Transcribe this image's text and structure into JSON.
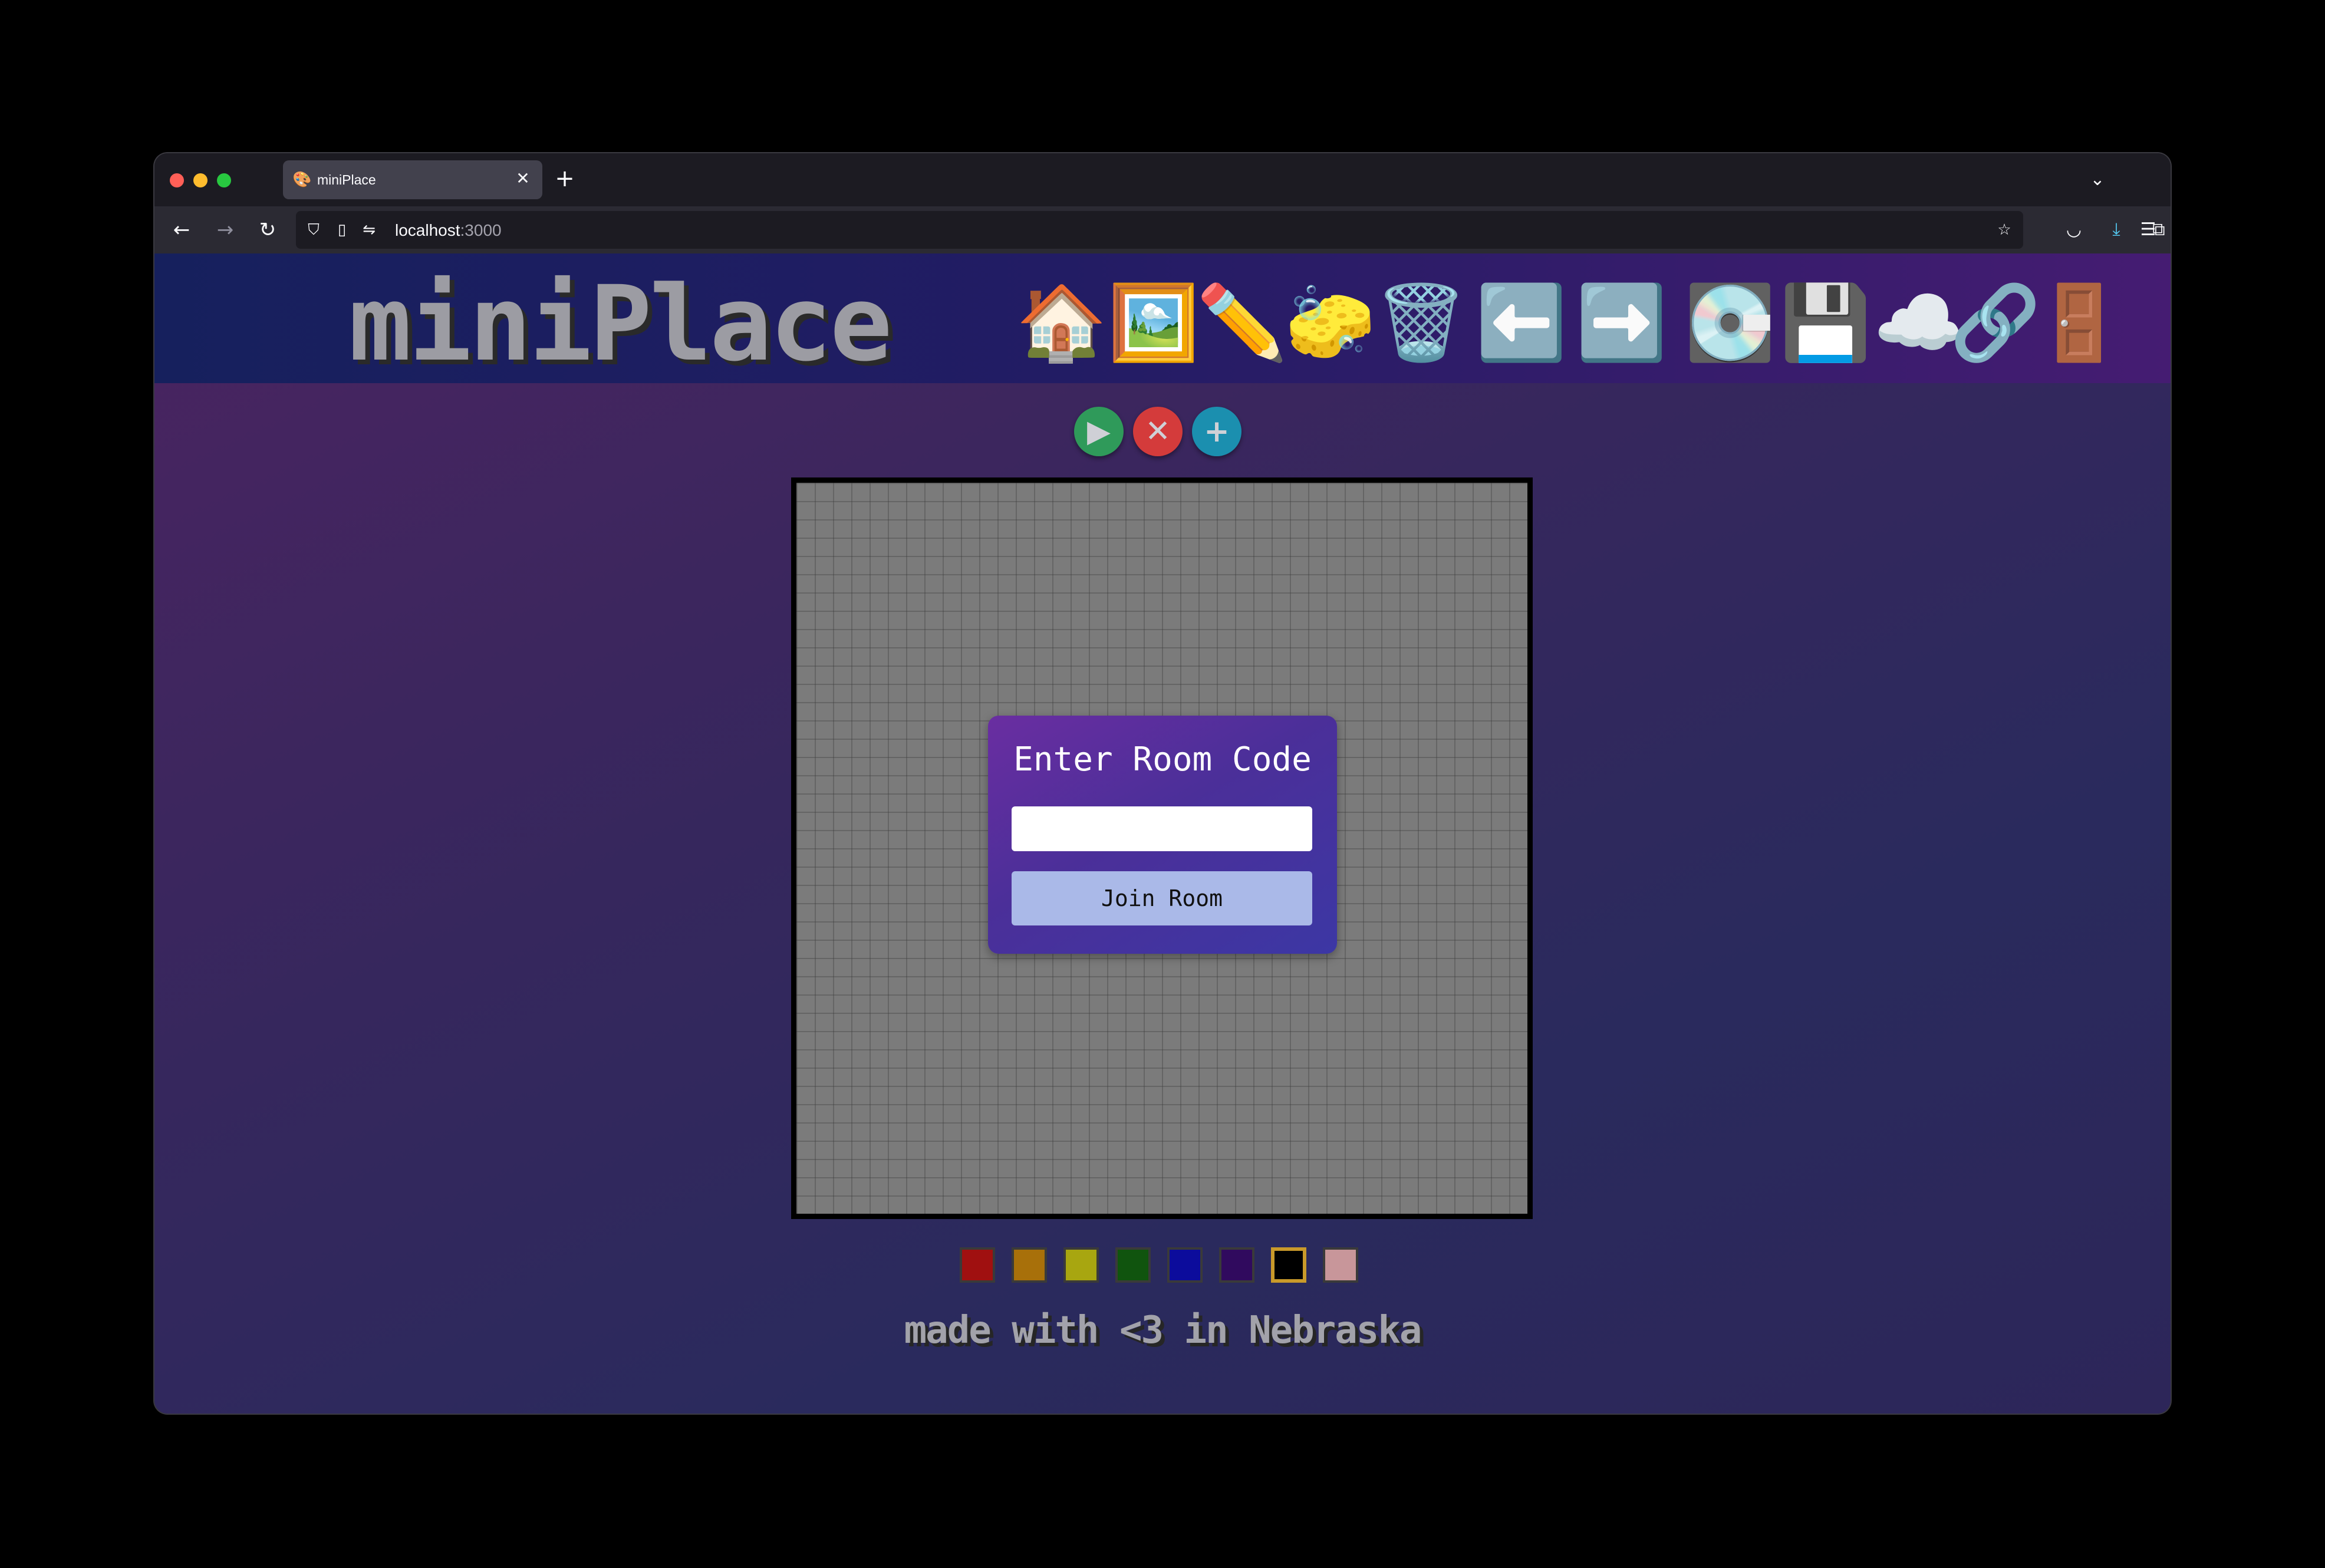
{
  "browser": {
    "tab_title": "miniPlace",
    "tab_favicon": "🎨",
    "tab_close": "✕",
    "new_tab": "+",
    "tab_list": "⌄",
    "url_host": "localhost",
    "url_port": ":3000"
  },
  "header": {
    "logo_text": "miniPlace",
    "icons": [
      {
        "name": "home-icon",
        "glyph": "🏠"
      },
      {
        "name": "mona-lisa-icon",
        "glyph": "🖼️"
      },
      {
        "name": "pencil-icon",
        "glyph": "✏️"
      },
      {
        "name": "eraser-icon",
        "glyph": "🧽"
      },
      {
        "name": "trash-icon",
        "glyph": "🗑️"
      },
      {
        "name": "undo-arrow-icon",
        "glyph": "⬅️"
      },
      {
        "name": "redo-arrow-icon",
        "glyph": "➡️"
      },
      {
        "name": "hard-drive-icon",
        "glyph": "💽"
      },
      {
        "name": "floppy-disk-icon",
        "glyph": "💾"
      },
      {
        "name": "cloud-download-icon",
        "glyph": "☁️"
      },
      {
        "name": "share-icon",
        "glyph": "🔗"
      },
      {
        "name": "exit-door-icon",
        "glyph": "🚪"
      }
    ]
  },
  "controls": {
    "play": "▶",
    "cancel": "✕",
    "add": "+"
  },
  "modal": {
    "title": "Enter Room Code",
    "input_value": "",
    "input_placeholder": "",
    "button_label": "Join Room"
  },
  "palette": {
    "colors": [
      "#a01010",
      "#a8700a",
      "#a8a610",
      "#10540e",
      "#0c0c9c",
      "#300a5e",
      "#000000",
      "#c8969a"
    ],
    "selected_index": 6
  },
  "footer": {
    "text": "made with <3 in Nebraska"
  },
  "colors": {
    "header_start": "#16205d",
    "header_end": "#451c72",
    "modal_button": "#aab9e8",
    "canvas_bg": "#7b7b7b"
  }
}
